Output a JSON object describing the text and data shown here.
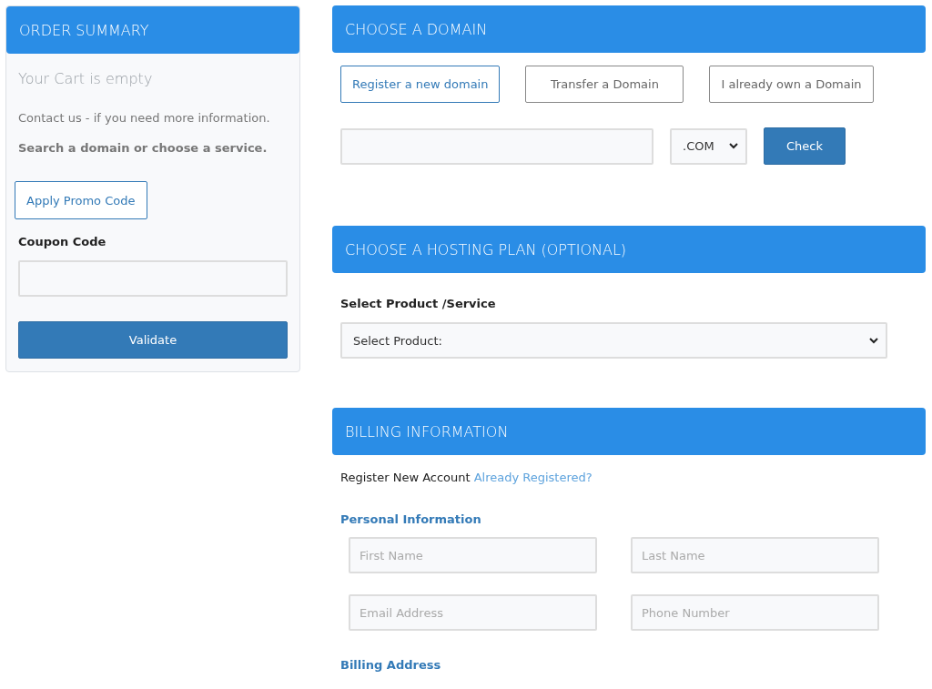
{
  "order_summary": {
    "title": "ORDER SUMMARY",
    "cart_status": "Your Cart is empty",
    "contact_text": "Contact us - if you need more information.",
    "hint": "Search a domain or choose a service.",
    "promo_button": "Apply Promo Code",
    "coupon_label": "Coupon Code",
    "validate_button": "Validate"
  },
  "domain": {
    "title": "CHOOSE A DOMAIN",
    "options": [
      {
        "label": "Register a new domain",
        "selected": true
      },
      {
        "label": "Transfer a Domain",
        "selected": false
      },
      {
        "label": "I already own a Domain",
        "selected": false
      }
    ],
    "tld": ".COM",
    "check_button": "Check"
  },
  "hosting": {
    "title": "CHOOSE A HOSTING PLAN (OPTIONAL)",
    "label": "Select Product /Service",
    "select_value": "Select Product:"
  },
  "billing": {
    "title": "BILLING INFORMATION",
    "register_text": "Register New Account",
    "login_link": "Already Registered?",
    "personal_heading": "Personal Information",
    "fields": [
      {
        "placeholder": "First Name"
      },
      {
        "placeholder": "Last Name"
      },
      {
        "placeholder": "Email Address"
      },
      {
        "placeholder": "Phone Number"
      }
    ],
    "address_heading": "Billing Address"
  }
}
